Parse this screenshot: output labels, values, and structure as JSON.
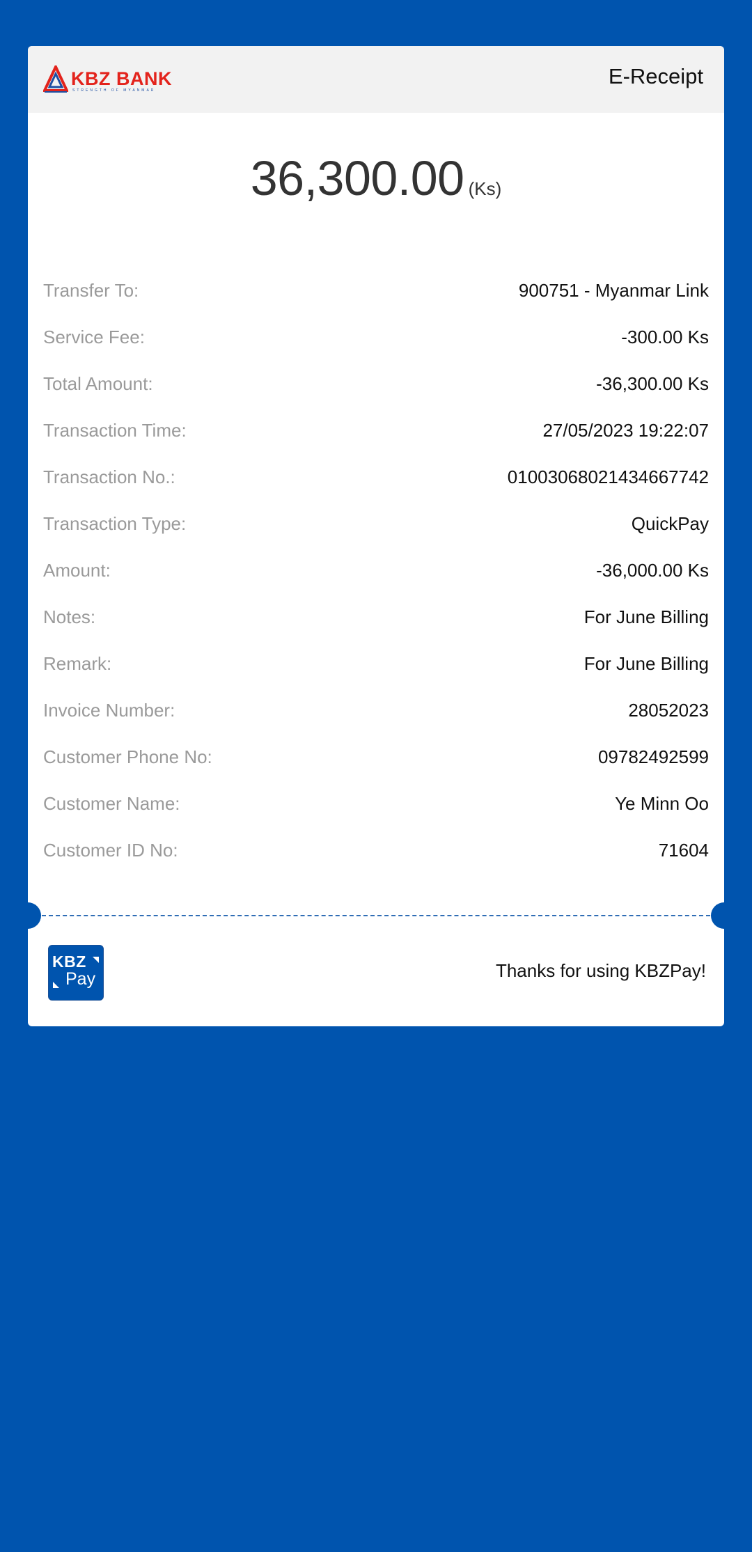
{
  "header": {
    "logo_text": "KBZ BANK",
    "logo_tagline": "STRENGTH OF MYANMAR",
    "title": "E-Receipt"
  },
  "amount": {
    "value": "36,300.00",
    "unit": "(Ks)"
  },
  "details": [
    {
      "label": "Transfer To:",
      "value": "900751 - Myanmar Link"
    },
    {
      "label": "Service Fee:",
      "value": "-300.00 Ks"
    },
    {
      "label": "Total Amount:",
      "value": "-36,300.00 Ks"
    },
    {
      "label": "Transaction Time:",
      "value": "27/05/2023 19:22:07"
    },
    {
      "label": "Transaction No.:",
      "value": "01003068021434667742"
    },
    {
      "label": "Transaction Type:",
      "value": "QuickPay"
    },
    {
      "label": "Amount:",
      "value": "-36,000.00 Ks"
    },
    {
      "label": "Notes:",
      "value": "For June Billing"
    },
    {
      "label": "Remark:",
      "value": "For June Billing"
    },
    {
      "label": "Invoice Number:",
      "value": "28052023"
    },
    {
      "label": "Customer Phone No:",
      "value": "09782492599"
    },
    {
      "label": "Customer Name:",
      "value": "Ye Minn Oo"
    },
    {
      "label": "Customer ID No:",
      "value": "71604"
    }
  ],
  "footer": {
    "pay_logo_top": "KBZ",
    "pay_logo_bottom": "Pay",
    "thanks": "Thanks for using KBZPay!"
  },
  "colors": {
    "background": "#0054ae",
    "brand_red": "#e3231c",
    "label_gray": "#9a9a9a"
  }
}
